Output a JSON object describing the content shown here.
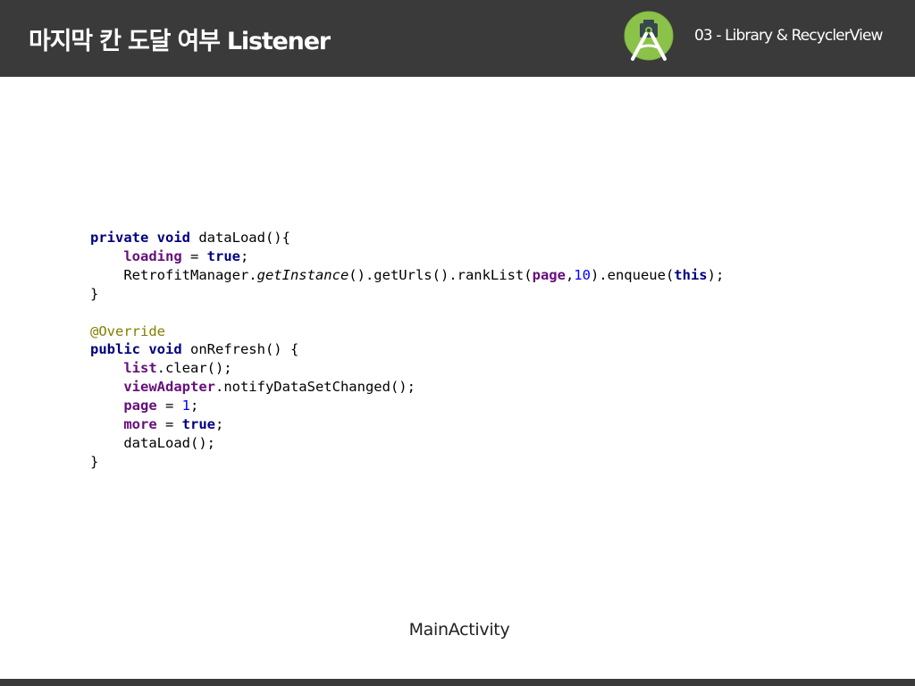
{
  "header": {
    "title": "마지막 칸 도달 여부 Listener",
    "section_label": "03 - Library & RecyclerView",
    "logo_icon": "android-studio-icon"
  },
  "code": {
    "lines": [
      [
        {
          "t": "private void",
          "c": "kw"
        },
        {
          "t": " dataLoad(){"
        }
      ],
      [
        {
          "t": "    "
        },
        {
          "t": "loading",
          "c": "fld"
        },
        {
          "t": " = "
        },
        {
          "t": "true",
          "c": "kw"
        },
        {
          "t": ";"
        }
      ],
      [
        {
          "t": "    RetrofitManager."
        },
        {
          "t": "getInstance",
          "c": "ital"
        },
        {
          "t": "().getUrls().rankList("
        },
        {
          "t": "page",
          "c": "fld"
        },
        {
          "t": ","
        },
        {
          "t": "10",
          "c": "num"
        },
        {
          "t": ").enqueue("
        },
        {
          "t": "this",
          "c": "kw"
        },
        {
          "t": ");"
        }
      ],
      [
        {
          "t": "}"
        }
      ],
      [
        {
          "t": ""
        }
      ],
      [
        {
          "t": "@Override",
          "c": "ann"
        }
      ],
      [
        {
          "t": "public void",
          "c": "kw"
        },
        {
          "t": " onRefresh() {"
        }
      ],
      [
        {
          "t": "    "
        },
        {
          "t": "list",
          "c": "fld"
        },
        {
          "t": ".clear();"
        }
      ],
      [
        {
          "t": "    "
        },
        {
          "t": "viewAdapter",
          "c": "fld"
        },
        {
          "t": ".notifyDataSetChanged();"
        }
      ],
      [
        {
          "t": "    "
        },
        {
          "t": "page",
          "c": "fld"
        },
        {
          "t": " = "
        },
        {
          "t": "1",
          "c": "num"
        },
        {
          "t": ";"
        }
      ],
      [
        {
          "t": "    "
        },
        {
          "t": "more",
          "c": "fld"
        },
        {
          "t": " = "
        },
        {
          "t": "true",
          "c": "kw"
        },
        {
          "t": ";"
        }
      ],
      [
        {
          "t": "    dataLoad();"
        }
      ],
      [
        {
          "t": "}"
        }
      ]
    ]
  },
  "caption": "MainActivity",
  "colors": {
    "header_bg": "#3a3a3a",
    "keyword": "#000080",
    "field": "#660e7a",
    "number": "#0000ff",
    "annotation": "#808000",
    "logo_green": "#8bc34a"
  }
}
